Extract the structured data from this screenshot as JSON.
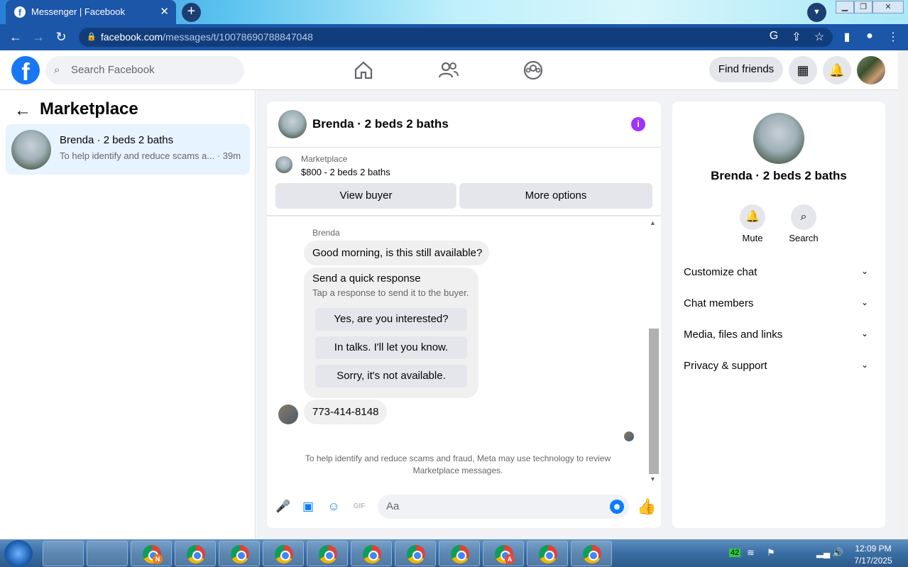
{
  "browser": {
    "tab_title": "Messenger | Facebook",
    "tab_close": "✕",
    "new_tab": "+",
    "url_host": "facebook.com",
    "url_path": "/messages/t/10078690788847048"
  },
  "header": {
    "search_placeholder": "Search Facebook",
    "find_friends": "Find friends"
  },
  "left": {
    "title": "Marketplace",
    "chat": {
      "name": "Brenda · 2 beds 2 baths",
      "preview": "To help identify and reduce scams a...",
      "time": "39m"
    }
  },
  "conversation": {
    "title": "Brenda · 2 beds 2 baths",
    "marketplace_label": "Marketplace",
    "listing": "$800 - 2 beds 2 baths",
    "view_buyer": "View buyer",
    "more_options": "More options",
    "sender": "Brenda",
    "message1": "Good morning, is this still available?",
    "quick_title": "Send a quick response",
    "quick_sub": "Tap a response to send it to the buyer.",
    "quick_options": [
      "Yes, are you interested?",
      "In talks. I'll let you know.",
      "Sorry, it's not available."
    ],
    "message2": "773-414-8148",
    "disclaimer": "To help identify and reduce scams and fraud, Meta may use technology to review Marketplace messages.",
    "composer_placeholder": "Aa"
  },
  "right": {
    "name": "Brenda · 2 beds 2 baths",
    "mute": "Mute",
    "search": "Search",
    "sections": [
      "Customize chat",
      "Chat members",
      "Media, files and links",
      "Privacy & support"
    ]
  },
  "taskbar": {
    "time": "12:09 PM",
    "date": "7/17/2025",
    "tray_badge": "42",
    "badges": [
      "N",
      "",
      "",
      "",
      "",
      "",
      "",
      "",
      "A",
      "",
      ""
    ]
  }
}
